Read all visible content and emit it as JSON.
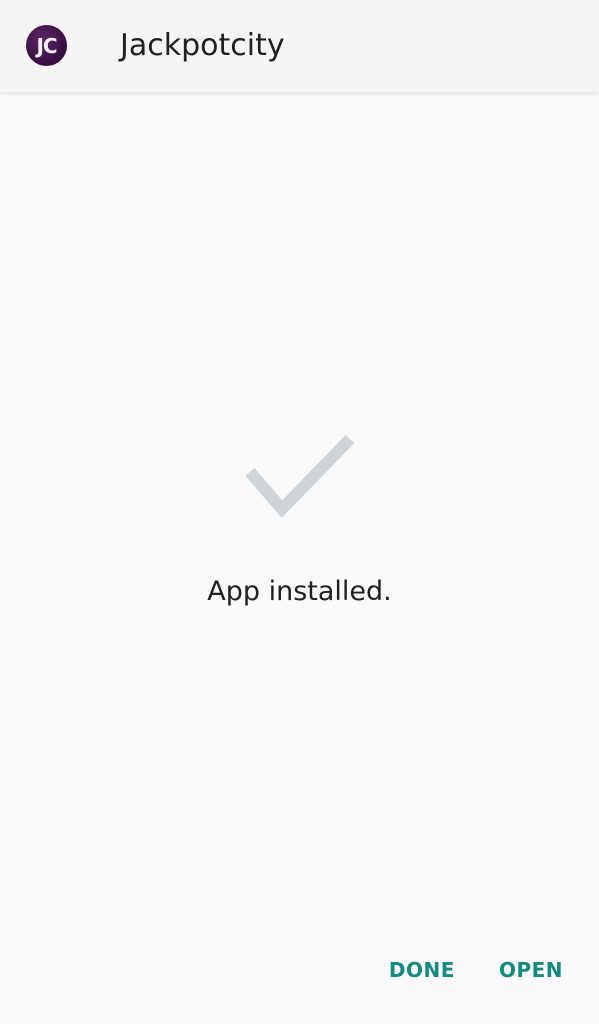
{
  "header": {
    "app_icon_text": "JC",
    "app_name": "Jackpotcity"
  },
  "main": {
    "status_icon": "checkmark-icon",
    "status_text": "App installed."
  },
  "actions": {
    "done_label": "DONE",
    "open_label": "OPEN"
  },
  "colors": {
    "accent": "#138b7d",
    "checkmark": "#cfd4d8",
    "app_icon_bg": "#3a1143"
  }
}
